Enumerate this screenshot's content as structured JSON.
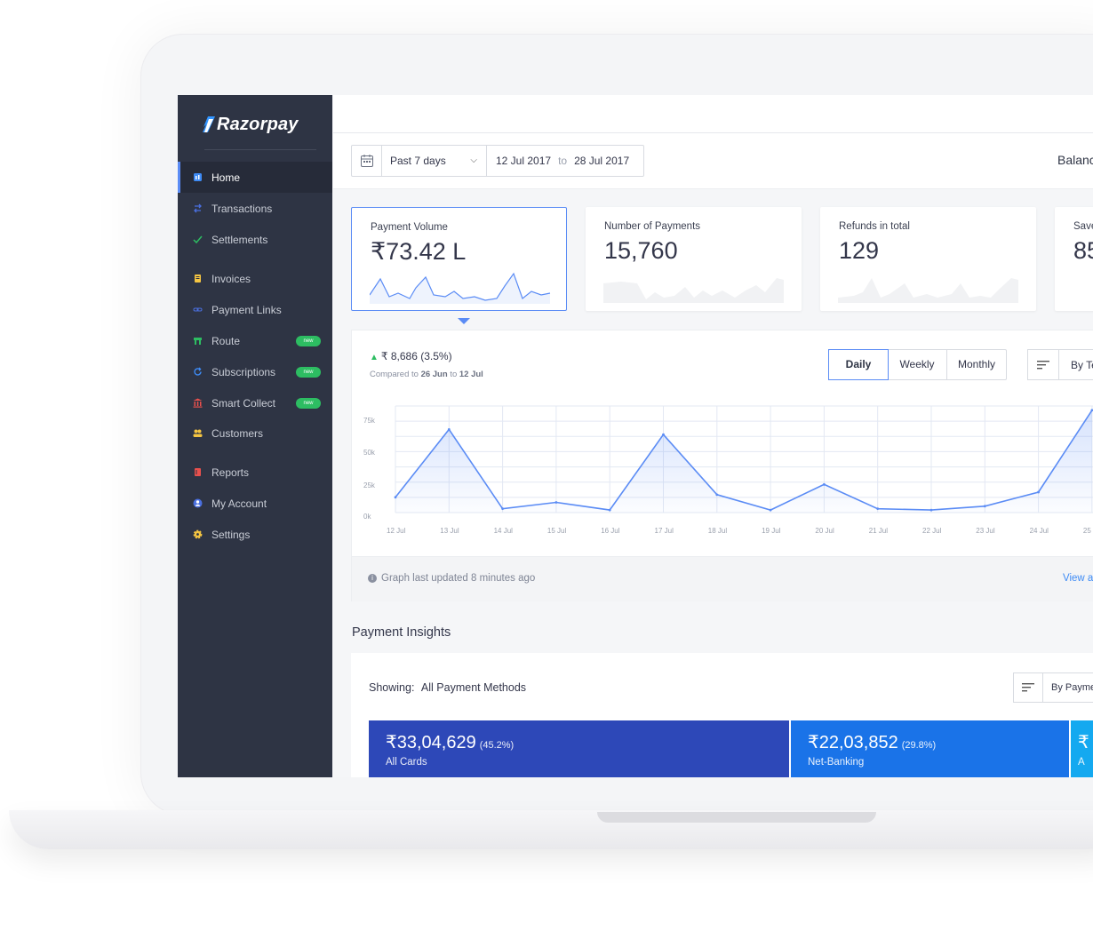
{
  "brand": {
    "name": "Razorpay"
  },
  "sidebar": {
    "items": [
      {
        "label": "Home",
        "icon": "home-icon",
        "color": "#3e8bf5"
      },
      {
        "label": "Transactions",
        "icon": "transactions-icon",
        "color": "#4a6fe0"
      },
      {
        "label": "Settlements",
        "icon": "check-icon",
        "color": "#2dbd62"
      },
      {
        "label": "Invoices",
        "icon": "invoice-icon",
        "color": "#f5c542"
      },
      {
        "label": "Payment Links",
        "icon": "link-icon",
        "color": "#4a6fe0"
      },
      {
        "label": "Route",
        "icon": "route-icon",
        "color": "#2dbd62",
        "badge": "new"
      },
      {
        "label": "Subscriptions",
        "icon": "refresh-icon",
        "color": "#3e8bf5",
        "badge": "new"
      },
      {
        "label": "Smart Collect",
        "icon": "bank-icon",
        "color": "#e8504d",
        "badge": "new"
      },
      {
        "label": "Customers",
        "icon": "customers-icon",
        "color": "#f5c542"
      },
      {
        "label": "Reports",
        "icon": "reports-icon",
        "color": "#e8504d"
      },
      {
        "label": "My Account",
        "icon": "account-icon",
        "color": "#4a6fe0"
      },
      {
        "label": "Settings",
        "icon": "gear-icon",
        "color": "#f5c542"
      }
    ]
  },
  "filters": {
    "range": "Past 7 days",
    "from": "12 Jul 2017",
    "to_word": "to",
    "to": "28 Jul 2017",
    "balance_label": "Balanc"
  },
  "cards": [
    {
      "label": "Payment Volume",
      "value": "₹73.42 L"
    },
    {
      "label": "Number of Payments",
      "value": "15,760"
    },
    {
      "label": "Refunds in total",
      "value": "129"
    },
    {
      "label": "Save",
      "value": "85"
    }
  ],
  "graph": {
    "delta": "₹ 8,686",
    "delta_pct": "(3.5%)",
    "compared_prefix": "Compared to",
    "compared_from": "26 Jun",
    "compared_mid": "to",
    "compared_to": "12 Jul",
    "tabs": [
      "Daily",
      "Weekly",
      "Monthly"
    ],
    "active_tab": "Daily",
    "by_label": "By Te",
    "footer": "Graph last updated 8 minutes ago",
    "view_all": "View a"
  },
  "chart_data": {
    "type": "area",
    "x": [
      "12 Jul",
      "13 Jul",
      "14 Jul",
      "15 Jul",
      "16 Jul",
      "17 Jul",
      "18 Jul",
      "19 Jul",
      "20 Jul",
      "21 Jul",
      "22 Jul",
      "23 Jul",
      "24 Jul",
      "25 Jul"
    ],
    "y_ticks": [
      "75k",
      "50k",
      "25k",
      "0k"
    ],
    "series": [
      {
        "values": [
          12000,
          65000,
          3000,
          8000,
          2000,
          61000,
          14000,
          2000,
          22000,
          3000,
          2000,
          5000,
          16000,
          80000
        ]
      }
    ],
    "ylim": [
      0,
      75000
    ],
    "grid": true,
    "color": "#5b8cf5"
  },
  "insights": {
    "title": "Payment Insights",
    "showing_label": "Showing:",
    "showing_value": "All Payment Methods",
    "by_label": "By Payme",
    "tiles": [
      {
        "amount": "₹33,04,629",
        "pct": "(45.2%)",
        "name": "All Cards",
        "color": "#2d48b8"
      },
      {
        "amount": "₹22,03,852",
        "pct": "(29.8%)",
        "name": "Net-Banking",
        "color": "#1a73e8"
      },
      {
        "amount": "₹",
        "pct": "",
        "name": "A",
        "color": "#14a9f0"
      }
    ]
  }
}
